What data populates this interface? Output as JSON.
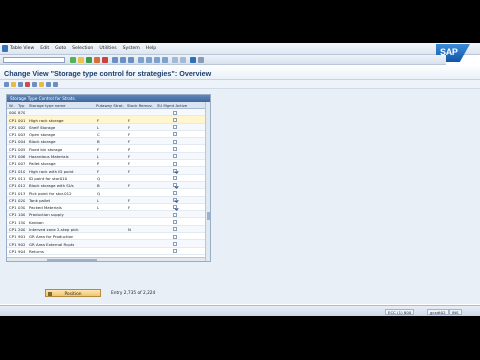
{
  "menu": [
    "Table View",
    "Edit",
    "Goto",
    "Selection",
    "Utilities",
    "System",
    "Help"
  ],
  "sap_logo_text": "SAP",
  "title": "Change View \"Storage type control for strategies\": Overview",
  "table": {
    "title": "Storage Type Control for Strats.",
    "columns": [
      "W..",
      "Typ",
      "Storage type name",
      "Putaway Strat.",
      "Stock Remov.",
      "SU Mgmt Active"
    ],
    "rows": [
      {
        "w": "000",
        "typ": "870",
        "name": "",
        "put": "",
        "rem": "",
        "su": false
      },
      {
        "w": "CP1",
        "typ": "001",
        "name": "High rack storage",
        "put": "F",
        "rem": "F",
        "su": false
      },
      {
        "w": "CP1",
        "typ": "002",
        "name": "Shelf Storage",
        "put": "L",
        "rem": "F",
        "su": false
      },
      {
        "w": "CP1",
        "typ": "003",
        "name": "Open storage",
        "put": "C",
        "rem": "F",
        "su": false
      },
      {
        "w": "CP1",
        "typ": "004",
        "name": "Block storage",
        "put": "B",
        "rem": "F",
        "su": false
      },
      {
        "w": "CP1",
        "typ": "005",
        "name": "Fixed bin storage",
        "put": "F",
        "rem": "P",
        "su": false
      },
      {
        "w": "CP1",
        "typ": "006",
        "name": "Hazardous Materials",
        "put": "L",
        "rem": "F",
        "su": false
      },
      {
        "w": "CP1",
        "typ": "007",
        "name": "Pallet storage",
        "put": "P",
        "rem": "F",
        "su": false
      },
      {
        "w": "CP1",
        "typ": "010",
        "name": "High rack with ID point",
        "put": "F",
        "rem": "F",
        "su": true
      },
      {
        "w": "CP1",
        "typ": "011",
        "name": "ID point for stor010",
        "put": "Q",
        "rem": "",
        "su": false
      },
      {
        "w": "CP1",
        "typ": "012",
        "name": "Block storage with SUs",
        "put": "B",
        "rem": "F",
        "su": true
      },
      {
        "w": "CP1",
        "typ": "013",
        "name": "Pick point for stor.012",
        "put": "Q",
        "rem": "",
        "su": false
      },
      {
        "w": "CP1",
        "typ": "020",
        "name": "Tank pallet",
        "put": "L",
        "rem": "F",
        "su": true
      },
      {
        "w": "CP1",
        "typ": "030",
        "name": "Packed Materials",
        "put": "L",
        "rem": "F",
        "su": true
      },
      {
        "w": "CP1",
        "typ": "100",
        "name": "Production supply",
        "put": "",
        "rem": "",
        "su": false
      },
      {
        "w": "CP1",
        "typ": "150",
        "name": "Kanban",
        "put": "",
        "rem": "",
        "su": false
      },
      {
        "w": "CP1",
        "typ": "200",
        "name": "Interved zone 2-step pick",
        "put": "",
        "rem": "N",
        "su": false
      },
      {
        "w": "CP1",
        "typ": "901",
        "name": "GR Area for Production",
        "put": "",
        "rem": "",
        "su": false
      },
      {
        "w": "CP1",
        "typ": "902",
        "name": "GR Area External Rcpts",
        "put": "",
        "rem": "",
        "su": false
      },
      {
        "w": "CP1",
        "typ": "904",
        "name": "Returns",
        "put": "",
        "rem": "",
        "su": false
      }
    ],
    "selected_row": 1
  },
  "position_label": "Position",
  "entry_count": "Entry 2,735 of 2,224",
  "status": {
    "system": "ECC (1) 800",
    "server": "gcsdt02",
    "mode": "INS"
  }
}
